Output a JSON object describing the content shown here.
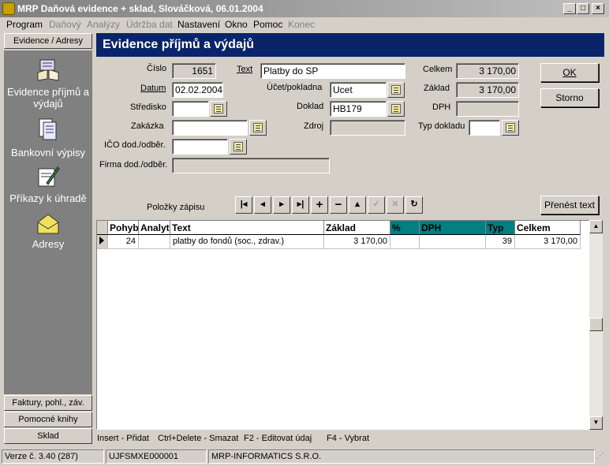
{
  "window": {
    "title": "MRP Daňová evidence + sklad, Slováčková, 06.01.2004"
  },
  "menu": {
    "items": [
      {
        "label": "Program",
        "enabled": true
      },
      {
        "label": "Daňový",
        "enabled": false
      },
      {
        "label": "Analýzy",
        "enabled": false
      },
      {
        "label": "Údržba dat",
        "enabled": false
      },
      {
        "label": "Nastavení",
        "enabled": true
      },
      {
        "label": "Okno",
        "enabled": true
      },
      {
        "label": "Pomoc",
        "enabled": true
      },
      {
        "label": "Konec",
        "enabled": false
      }
    ]
  },
  "sidebar": {
    "top_tab": "Evidence / Adresy",
    "items": [
      {
        "label": "Evidence příjmů a výdajů",
        "icon": "book-icon"
      },
      {
        "label": "Bankovní výpisy",
        "icon": "documents-icon"
      },
      {
        "label": "Příkazy k úhradě",
        "icon": "pen-paper-icon"
      },
      {
        "label": "Adresy",
        "icon": "envelope-icon"
      }
    ],
    "bottom_tabs": [
      "Faktury, pohl., záv.",
      "Pomocné knihy",
      "Sklad"
    ]
  },
  "header": {
    "title": "Evidence příjmů a výdajů"
  },
  "form": {
    "cislo_label": "Číslo",
    "cislo_value": "1651",
    "datum_label": "Datum",
    "datum_value": "02.02.2004",
    "stredisko_label": "Středisko",
    "stredisko_value": "",
    "zakazka_label": "Zakázka",
    "zakazka_value": "",
    "ico_label": "IČO dod./odběr.",
    "ico_value": "",
    "firma_label": "Firma dod./odběr.",
    "firma_value": "",
    "text_label": "Text",
    "text_value": "Platby do SP",
    "ucet_label": "Účet/pokladna",
    "ucet_value": "Ucet",
    "doklad_label": "Doklad",
    "doklad_value": "HB179",
    "zdroj_label": "Zdroj",
    "zdroj_value": "",
    "celkem_label": "Celkem",
    "celkem_value": "3 170,00",
    "zaklad_label": "Základ",
    "zaklad_value": "3 170,00",
    "dph_label": "DPH",
    "dph_value": "",
    "typ_label": "Typ dokladu",
    "typ_value": ""
  },
  "buttons": {
    "ok": "OK",
    "storno": "Storno",
    "prenest": "Přenést text"
  },
  "items_label": "Položky zápisu",
  "grid": {
    "columns": [
      "Pohyb",
      "Analyt",
      "Text",
      "Základ",
      "%",
      "DPH",
      "Typ",
      "Celkem"
    ],
    "rows": [
      [
        "24",
        "",
        "platby do fondů (soc., zdrav.)",
        "3 170,00",
        "",
        "",
        "39",
        "3 170,00"
      ]
    ]
  },
  "hints": [
    "Insert - Přidat",
    "Ctrl+Delete - Smazat",
    "F2 - Editovat údaj",
    "F4 - Vybrat"
  ],
  "statusbar": [
    "Verze č. 3.40 (287)",
    "UJFSMXE000001",
    "MRP-INFORMATICS S.R.O."
  ]
}
